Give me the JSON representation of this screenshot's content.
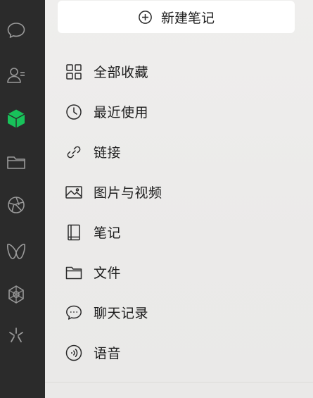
{
  "colors": {
    "rail_bg": "#2b2b2b",
    "rail_icon": "#9a9a9a",
    "accent": "#18c25a",
    "panel_bg": "#ecebea",
    "text": "#1c1c1c"
  },
  "rail": {
    "items": [
      {
        "name": "chat-icon"
      },
      {
        "name": "contacts-icon"
      },
      {
        "name": "favorites-cube-icon",
        "active": true
      },
      {
        "name": "folder-icon"
      },
      {
        "name": "aperture-icon"
      },
      {
        "name": "butterfly-icon"
      },
      {
        "name": "mini-programs-icon"
      },
      {
        "name": "sparkle-icon"
      }
    ]
  },
  "new_note": {
    "label": "新建笔记",
    "icon": "plus-circle-icon"
  },
  "nav": {
    "items": [
      {
        "label": "全部收藏",
        "icon": "grid-icon"
      },
      {
        "label": "最近使用",
        "icon": "clock-icon"
      },
      {
        "label": "链接",
        "icon": "link-icon"
      },
      {
        "label": "图片与视频",
        "icon": "image-icon"
      },
      {
        "label": "笔记",
        "icon": "notebook-icon"
      },
      {
        "label": "文件",
        "icon": "folder-icon"
      },
      {
        "label": "聊天记录",
        "icon": "chat-bubble-icon"
      },
      {
        "label": "语音",
        "icon": "voice-icon"
      }
    ]
  }
}
